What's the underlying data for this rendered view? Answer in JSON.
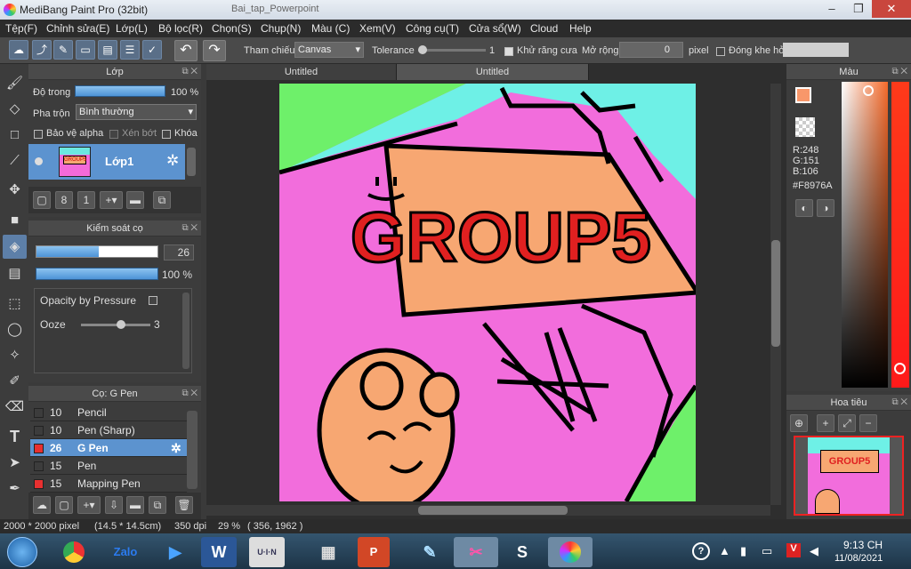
{
  "window": {
    "title": "MediBang Paint Pro (32bit)",
    "browser_tab": "Bai_tap_Powerpoint"
  },
  "menu": [
    "Tệp(F)",
    "Chỉnh sửa(E)",
    "Lớp(L)",
    "Bộ lọc(R)",
    "Chọn(S)",
    "Chụp(N)",
    "Màu (C)",
    "Xem(V)",
    "Công cụ(T)",
    "Cửa sổ(W)",
    "Cloud",
    "Help"
  ],
  "toolbar": {
    "ref_label": "Tham chiếu",
    "ref_value": "Canvas",
    "tolerance_label": "Tolerance",
    "tolerance_value": "1",
    "antialias_label": "Khử răng cưa",
    "expand_label": "Mở rộng",
    "expand_value": "0",
    "expand_unit": "pixel",
    "gap_label": "Đóng khe hở"
  },
  "layer_panel": {
    "title": "Lớp",
    "opacity_label": "Độ trong",
    "opacity_value": "100 %",
    "opacity": 1.0,
    "blend_label": "Pha trộn",
    "blend_value": "Bình thường",
    "protect_alpha": "Bảo vệ alpha",
    "clip": "Xén bớt",
    "lock": "Khóa",
    "layer_name": "Lớp1"
  },
  "brush_control": {
    "title": "Kiểm soát cọ",
    "size_value": "26",
    "opacity_value": "100 %",
    "opacity": 1.0,
    "opacity_pressure": "Opacity by Pressure",
    "ooze_label": "Ooze",
    "ooze_value": "3"
  },
  "brush_list": {
    "title": "Cọ: G Pen",
    "items": [
      {
        "size": "10",
        "name": "Pencil",
        "color": "#333333"
      },
      {
        "size": "10",
        "name": "Pen (Sharp)",
        "color": "#333333"
      },
      {
        "size": "26",
        "name": "G Pen",
        "color": "#e83030",
        "selected": true
      },
      {
        "size": "15",
        "name": "Pen",
        "color": "#333333"
      },
      {
        "size": "15",
        "name": "Mapping Pen",
        "color": "#e83030"
      }
    ]
  },
  "tabs": [
    "Untitled",
    "Untitled"
  ],
  "color_panel": {
    "title": "Màu",
    "r": "R:248",
    "g": "G:151",
    "b": "B:106",
    "hex": "#F8976A",
    "current": "#F8976A"
  },
  "navigator": {
    "title": "Hoa tiêu"
  },
  "status": {
    "size": "2000 * 2000 pixel",
    "physical": "(14.5 * 14.5cm)",
    "dpi": "350 dpi",
    "zoom": "29 %",
    "coords": "( 356, 1962 )"
  },
  "taskbar": {
    "time": "9:13 CH",
    "date": "11/08/2021",
    "apps": [
      "Zalo",
      "W",
      "U·I·N",
      "S"
    ]
  },
  "artwork": {
    "text": "GROUP5"
  }
}
